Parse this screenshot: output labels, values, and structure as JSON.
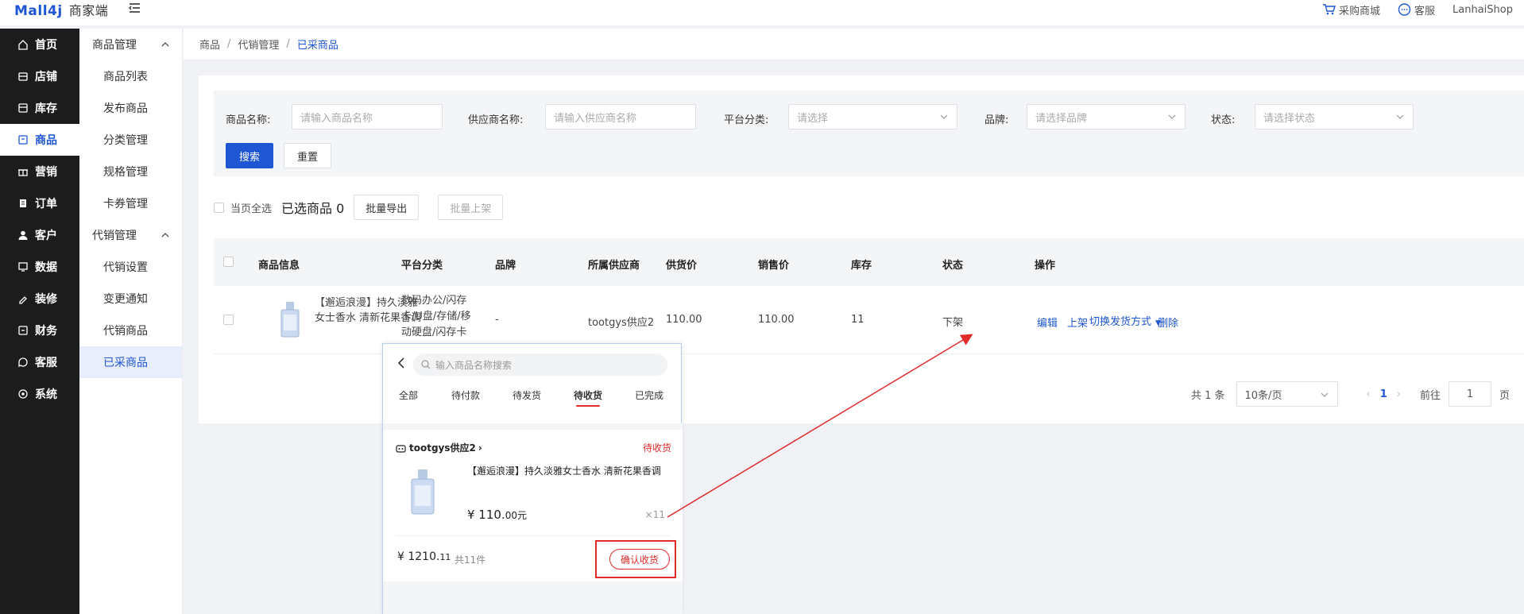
{
  "header": {
    "logo": "Mall4j",
    "shop_label": "商家端",
    "purchase_mall": "采购商城",
    "customer_service": "客服",
    "username": "LanhaiShop"
  },
  "sidebar": {
    "items": [
      {
        "label": "首页",
        "icon": "home-icon"
      },
      {
        "label": "店铺",
        "icon": "store-icon"
      },
      {
        "label": "库存",
        "icon": "inventory-icon"
      },
      {
        "label": "商品",
        "icon": "product-icon"
      },
      {
        "label": "营销",
        "icon": "gift-icon"
      },
      {
        "label": "订单",
        "icon": "order-icon"
      },
      {
        "label": "客户",
        "icon": "user-icon"
      },
      {
        "label": "数据",
        "icon": "data-icon"
      },
      {
        "label": "装修",
        "icon": "decorate-icon"
      },
      {
        "label": "财务",
        "icon": "finance-icon"
      },
      {
        "label": "客服",
        "icon": "chat-icon"
      },
      {
        "label": "系统",
        "icon": "settings-icon"
      }
    ],
    "active_index": 3
  },
  "submenu": {
    "group1": "商品管理",
    "group1_items": [
      "商品列表",
      "发布商品",
      "分类管理",
      "规格管理",
      "卡券管理"
    ],
    "group2": "代销管理",
    "group2_items": [
      "代销设置",
      "变更通知",
      "代销商品",
      "已采商品"
    ]
  },
  "breadcrumb": [
    "商品",
    "代销管理",
    "已采商品"
  ],
  "filter": {
    "product_name_label": "商品名称:",
    "product_name_placeholder": "请输入商品名称",
    "supplier_label": "供应商名称:",
    "supplier_placeholder": "请输入供应商名称",
    "category_label": "平台分类:",
    "category_placeholder": "请选择",
    "brand_label": "品牌:",
    "brand_placeholder": "请选择品牌",
    "status_label": "状态:",
    "status_placeholder": "请选择状态",
    "search_button": "搜索",
    "reset_button": "重置"
  },
  "batch": {
    "select_all": "当页全选",
    "selected_text": "已选商品 0",
    "export": "批量导出",
    "shelve": "批量上架"
  },
  "table": {
    "headers": [
      "商品信息",
      "平台分类",
      "品牌",
      "所属供应商",
      "供货价",
      "销售价",
      "库存",
      "状态",
      "操作"
    ],
    "row": {
      "name": "【邂逅浪漫】持久淡雅女士香水 清新花果香调",
      "category": "数码办公/闪存卡/U盘/存储/移动硬盘/闪存卡",
      "brand": "-",
      "supplier": "tootgys供应2",
      "supply_price": "110.00",
      "sale_price": "110.00",
      "stock": "11",
      "status": "下架",
      "actions": {
        "edit": "编辑",
        "shelve": "上架",
        "switch": "切换发货方式",
        "delete": "删除"
      }
    }
  },
  "pagination": {
    "total": "共 1 条",
    "page_size": "10条/页",
    "current": "1",
    "goto_label": "前往",
    "goto_value": "1",
    "page_suffix": "页"
  },
  "mobile": {
    "search_placeholder": "输入商品名称搜索",
    "tabs": [
      "全部",
      "待付款",
      "待发货",
      "待收货",
      "已完成"
    ],
    "active_tab": 3,
    "store": "tootgys供应2",
    "status": "待收货",
    "product_name": "【邂逅浪漫】持久淡雅女士香水 清新花果香调",
    "price_main": "¥ 110.",
    "price_decimal": "00元",
    "qty": "×11",
    "total_main": "¥ 1210.",
    "total_decimal": "11",
    "count": "共11件",
    "confirm": "确认收货"
  },
  "colors": {
    "brand": "#1f56d4",
    "sidebar_bg": "#1c1c1c",
    "alert_red": "#e02b2b"
  }
}
